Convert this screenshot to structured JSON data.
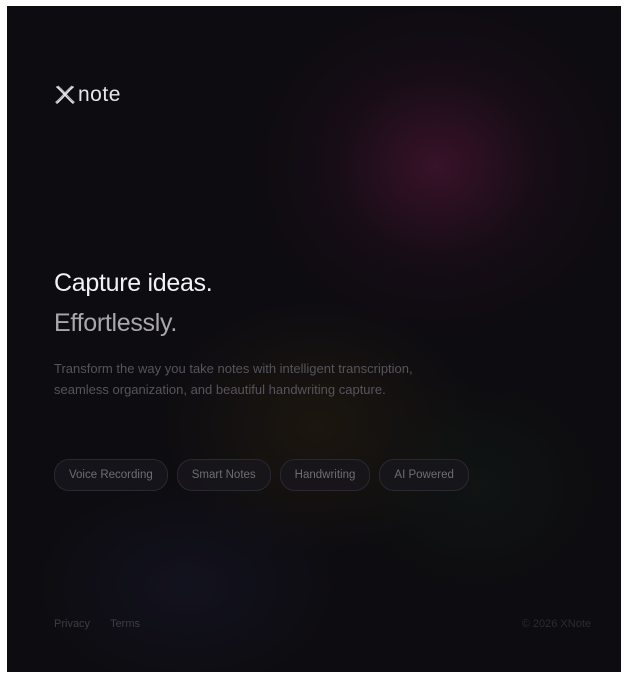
{
  "brand": {
    "name": "note",
    "logo_icon": "x-logo-mark"
  },
  "hero": {
    "headline": "Capture ideas.",
    "subheadline": "Effortlessly.",
    "description": "Transform the way you take notes with intelligent transcription, seamless organization, and beautiful handwriting capture."
  },
  "features": [
    {
      "label": "Voice Recording"
    },
    {
      "label": "Smart Notes"
    },
    {
      "label": "Handwriting"
    },
    {
      "label": "AI Powered"
    }
  ],
  "footer": {
    "links": [
      {
        "label": "Privacy"
      },
      {
        "label": "Terms"
      }
    ],
    "copyright": "© 2026 XNote"
  },
  "colors": {
    "background": "#0d0c10",
    "accent_glow": "#461430",
    "text_primary": "#f2f1f4",
    "text_secondary": "#a9a7ad",
    "text_muted": "#56545c"
  }
}
